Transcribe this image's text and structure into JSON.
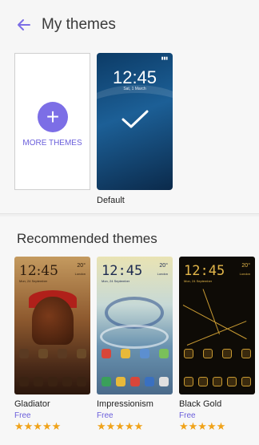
{
  "header": {
    "title": "My themes",
    "back_icon": "arrow-left-icon"
  },
  "my_themes": {
    "more_label": "MORE THEMES",
    "default_label": "Default",
    "default_preview": {
      "time": "12:45",
      "date": "Sat, 1 March"
    }
  },
  "recommended": {
    "title": "Recommended themes",
    "items": [
      {
        "name": "Gladiator",
        "price": "Free",
        "stars": "★★★★★",
        "preview_time": "12:45",
        "preview_date": "Mon, 24 September",
        "preview_temp": "20°",
        "preview_loc": "London"
      },
      {
        "name": "Impressionism",
        "price": "Free",
        "stars": "★★★★★",
        "preview_time": "12:45",
        "preview_date": "Mon, 24 September",
        "preview_temp": "20°",
        "preview_loc": "London"
      },
      {
        "name": "Black Gold",
        "price": "Free",
        "stars": "★★★★★",
        "preview_time": "12:45",
        "preview_date": "Mon, 24 September",
        "preview_temp": "20°",
        "preview_loc": "London"
      }
    ]
  },
  "colors": {
    "accent": "#7c6ee6",
    "star": "#f0a31a"
  }
}
